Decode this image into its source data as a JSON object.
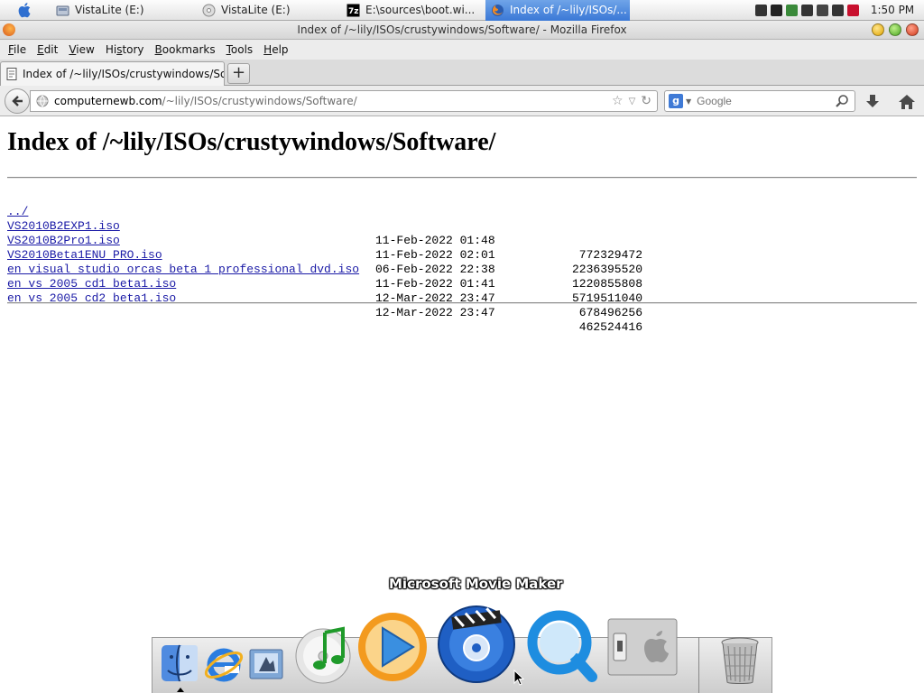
{
  "taskbar": {
    "apple_menu": "apple-icon",
    "tasks": [
      {
        "label": "VistaLite (E:)",
        "icon": "drive-icon",
        "active": false
      },
      {
        "label": "VistaLite (E:)",
        "icon": "disc-icon",
        "active": false
      },
      {
        "label": "E:\\sources\\boot.wi...",
        "icon": "7zip-icon",
        "active": false
      },
      {
        "label": "Index of /~lily/ISOs/...",
        "icon": "firefox-icon",
        "active": true
      }
    ],
    "clock": "1:50 PM"
  },
  "window": {
    "title": "Index of /~lily/ISOs/crustywindows/Software/ - Mozilla Firefox"
  },
  "menubar": {
    "items": [
      {
        "label": "File",
        "accel": "F"
      },
      {
        "label": "Edit",
        "accel": "E"
      },
      {
        "label": "View",
        "accel": "V"
      },
      {
        "label": "History",
        "accel": "s"
      },
      {
        "label": "Bookmarks",
        "accel": "B"
      },
      {
        "label": "Tools",
        "accel": "T"
      },
      {
        "label": "Help",
        "accel": "H"
      }
    ]
  },
  "tabs": [
    {
      "label": "Index of /~lily/ISOs/crustywindows/So...",
      "active": true
    }
  ],
  "new_tab_label": "+",
  "navbar": {
    "url_host": "computernewb.com",
    "url_path": "/~lily/ISOs/crustywindows/Software/",
    "search_placeholder": "Google",
    "search_engine_badge": "g"
  },
  "page": {
    "heading": "Index of /~lily/ISOs/crustywindows/Software/",
    "parent_link": "../",
    "files": [
      {
        "name": "VS2010B2EXP1.iso",
        "date": "11-Feb-2022 01:48",
        "size": "772329472"
      },
      {
        "name": "VS2010B2Pro1.iso",
        "date": "11-Feb-2022 02:01",
        "size": "2236395520"
      },
      {
        "name": "VS2010Beta1ENU_PRO.iso",
        "date": "06-Feb-2022 22:38",
        "size": "1220855808"
      },
      {
        "name": "en_visual_studio_orcas_beta_1_professional_dvd.iso",
        "date": "11-Feb-2022 01:41",
        "size": "5719511040"
      },
      {
        "name": "en_vs_2005_cd1_beta1.iso",
        "date": "12-Mar-2022 23:47",
        "size": "678496256"
      },
      {
        "name": "en_vs_2005_cd2_beta1.iso",
        "date": "12-Mar-2022 23:47",
        "size": "462524416"
      }
    ]
  },
  "dock": {
    "hover_label": "Microsoft Movie Maker",
    "items": [
      "finder-icon",
      "internet-explorer-icon",
      "mail-icon",
      "itunes-icon",
      "media-player-icon",
      "movie-maker-icon",
      "quicktime-icon",
      "system-preferences-icon",
      "trash-icon"
    ]
  }
}
